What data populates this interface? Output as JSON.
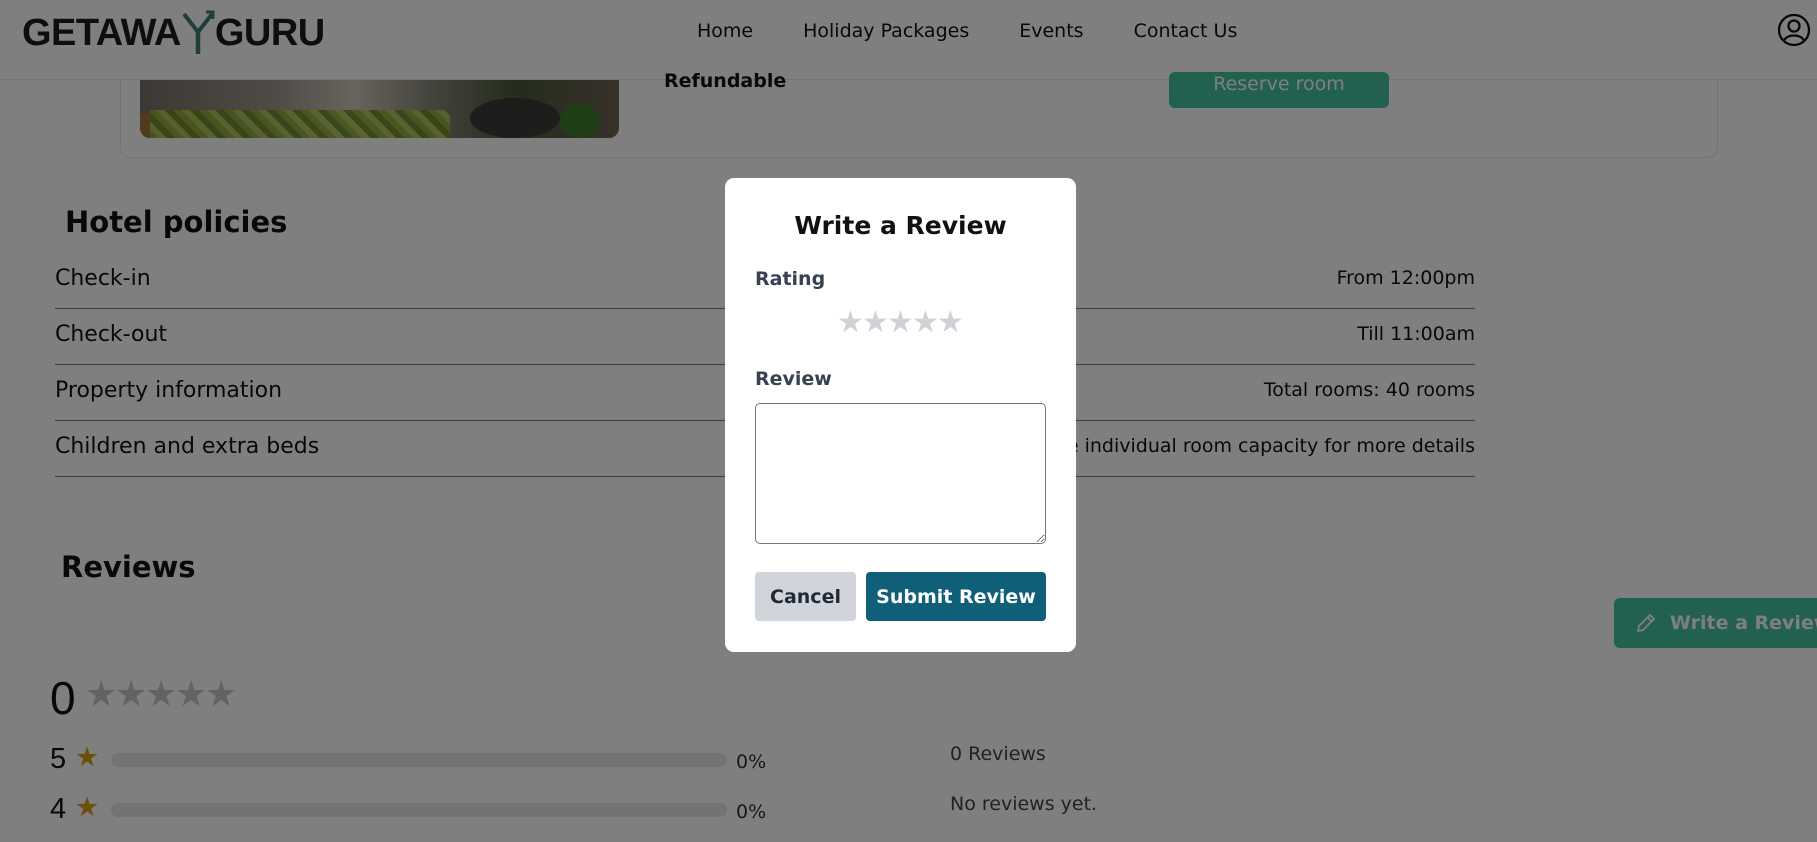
{
  "navbar": {
    "logo_left": "GETAWA",
    "logo_right": "GURU",
    "links": [
      "Home",
      "Holiday Packages",
      "Events",
      "Contact Us"
    ],
    "account_icon": "user-circle-icon"
  },
  "room": {
    "refundable_label": "Refundable",
    "reserve_label": "Reserve room"
  },
  "policies": {
    "title": "Hotel policies",
    "rows": [
      {
        "label": "Check-in",
        "value": "From 12:00pm"
      },
      {
        "label": "Check-out",
        "value": "Till 11:00am"
      },
      {
        "label": "Property information",
        "value": "Total rooms: 40 rooms"
      },
      {
        "label": "Children and extra beds",
        "value": "the individual room capacity for more details"
      }
    ]
  },
  "reviews": {
    "title": "Reviews",
    "average": "0",
    "average_stars": 0,
    "distribution": [
      {
        "stars": "5",
        "percent_label": "0%",
        "fraction": 0
      },
      {
        "stars": "4",
        "percent_label": "0%",
        "fraction": 0
      }
    ],
    "count_text": "0 Reviews",
    "empty_text": "No reviews yet.",
    "write_button_label": "Write a Review",
    "write_button_icon": "pencil-icon"
  },
  "modal": {
    "title": "Write a Review",
    "rating_label": "Rating",
    "rating_value": 0,
    "rating_max": 5,
    "review_label": "Review",
    "review_value": "",
    "cancel_label": "Cancel",
    "submit_label": "Submit Review"
  },
  "colors": {
    "accent_teal": "#45c29f",
    "submit_blue": "#0f5f78",
    "star_gold": "#d9a011",
    "star_empty": "#cfd1d6",
    "overlay": "rgba(0,0,0,0.5)"
  }
}
